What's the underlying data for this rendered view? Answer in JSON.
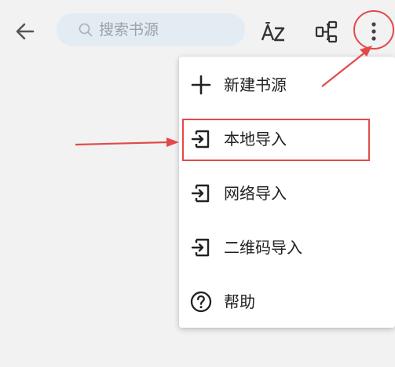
{
  "toolbar": {
    "back_icon": "arrow-left-icon",
    "search": {
      "placeholder": "搜索书源",
      "icon": "search-icon"
    },
    "sort_icon": "sort-az-icon",
    "group_icon": "group-icon",
    "more_icon": "more-vert-icon"
  },
  "menu": {
    "items": [
      {
        "label": "新建书源",
        "icon": "plus-icon"
      },
      {
        "label": "本地导入",
        "icon": "import-icon"
      },
      {
        "label": "网络导入",
        "icon": "import-icon"
      },
      {
        "label": "二维码导入",
        "icon": "import-icon"
      },
      {
        "label": "帮助",
        "icon": "help-circle-icon"
      }
    ]
  },
  "annotation": {
    "color": "#e24a4a"
  },
  "colors": {
    "background": "#f2f2f2",
    "search_bg": "#e3ebf3",
    "icon": "#555555",
    "menu_bg": "#ffffff"
  }
}
